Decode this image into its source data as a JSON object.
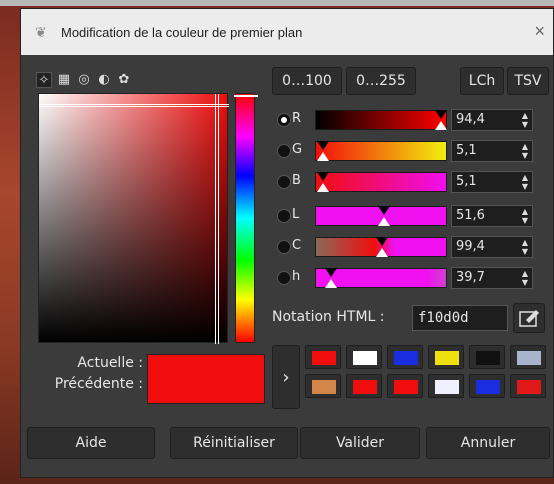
{
  "window": {
    "title": "Modification de la couleur de premier plan",
    "close_glyph": "×"
  },
  "range_buttons": [
    "0…100",
    "0…255"
  ],
  "mode_buttons": [
    "LCh",
    "TSV"
  ],
  "icon_tabs": [
    "scales-icon",
    "cmyk-icon",
    "watercolor-icon",
    "wheel-icon",
    "palette-icon"
  ],
  "channels": [
    {
      "label": "R",
      "value": "94,4",
      "level": 0.944,
      "selected": true
    },
    {
      "label": "G",
      "value": "5,1",
      "level": 0.051,
      "selected": false
    },
    {
      "label": "B",
      "value": "5,1",
      "level": 0.051,
      "selected": false
    },
    {
      "label": "L",
      "value": "51,6",
      "level": 0.516,
      "selected": false
    },
    {
      "label": "C",
      "value": "99,4",
      "level": 0.497,
      "selected": false
    },
    {
      "label": "h",
      "value": "39,7",
      "level": 0.11,
      "selected": false
    }
  ],
  "html_notation": {
    "label": "Notation HTML :",
    "value": "f10d0d"
  },
  "current": {
    "label_current": "Actuelle :",
    "label_previous": "Précédente :",
    "color": "#f10d0d"
  },
  "history_glyph": "›",
  "history_colors": [
    "#f10d0d",
    "#ffffff",
    "#1a2ee0",
    "#f0e010",
    "#111111",
    "#a8b4cc",
    "#d4874a",
    "#f10d0d",
    "#f10d0d",
    "#f0f0ff",
    "#1a2ee0",
    "#e01818"
  ],
  "footer": {
    "help": "Aide",
    "reset": "Réinitialiser",
    "ok": "Valider",
    "cancel": "Annuler"
  },
  "colors": {
    "accent": "#f10d0d",
    "panel": "#3b3b3b"
  }
}
